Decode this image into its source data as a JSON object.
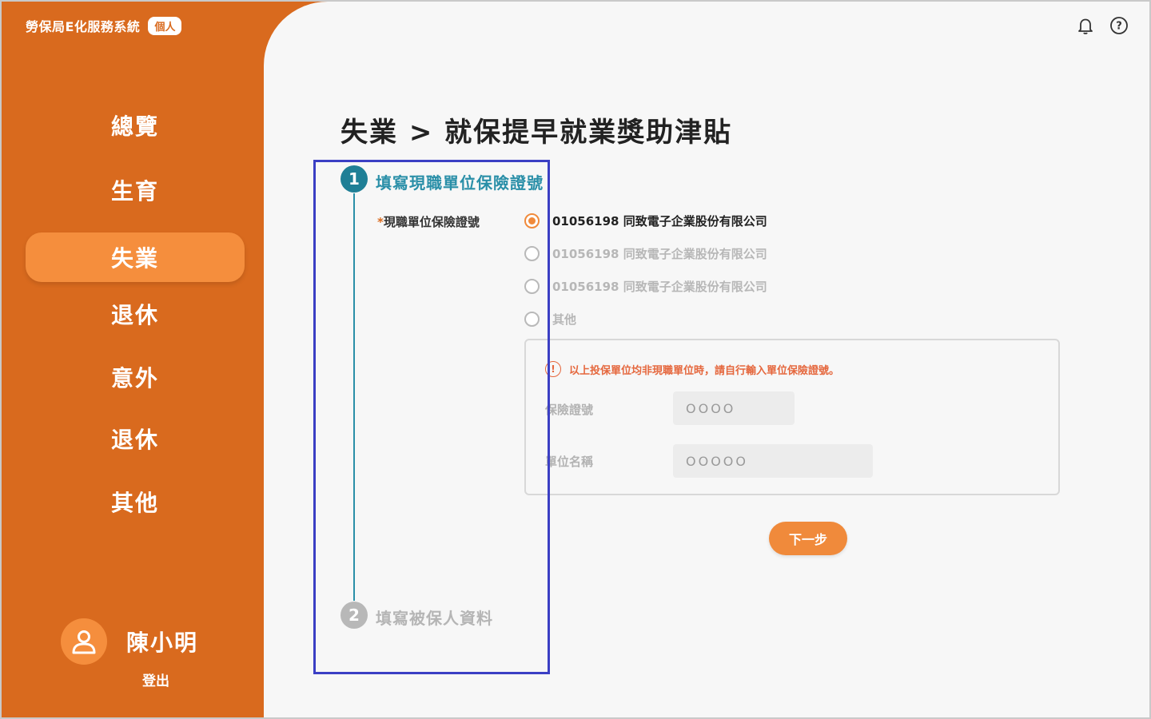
{
  "brand": {
    "title": "勞保局E化服務系統",
    "badge": "個人"
  },
  "nav": {
    "items": [
      {
        "label": "總覽"
      },
      {
        "label": "生育"
      },
      {
        "label": "失業"
      },
      {
        "label": "退休"
      },
      {
        "label": "意外"
      },
      {
        "label": "退休"
      },
      {
        "label": "其他"
      }
    ],
    "active_index": 2
  },
  "user": {
    "name": "陳小明",
    "logout_label": "登出",
    "avatar_icon": "user-icon"
  },
  "header": {
    "notification_icon": "bell-icon",
    "help_icon": "question-icon",
    "help_glyph": "?"
  },
  "page": {
    "title": "失業 > 就保提早就業獎助津貼"
  },
  "stepper": {
    "steps": [
      {
        "number": "1",
        "label": "填寫現職單位保險證號"
      },
      {
        "number": "2",
        "label": "填寫被保人資料"
      }
    ]
  },
  "form": {
    "required_mark": "*",
    "field_label": "現職單位保險證號",
    "options": [
      {
        "label": "01056198 同致電子企業股份有限公司",
        "checked": true
      },
      {
        "label": "01056198 同致電子企業股份有限公司",
        "checked": false
      },
      {
        "label": "01056198 同致電子企業股份有限公司",
        "checked": false
      },
      {
        "label": "其他",
        "checked": false
      }
    ],
    "warning_glyph": "!",
    "warning": "以上投保單位均非現職單位時，請自行輸入單位保險證號。",
    "insurance_no_label": "保險證號",
    "insurance_no_value": "OOOO",
    "unit_name_label": "單位名稱",
    "unit_name_value": "OOOOO",
    "next_label": "下一步"
  },
  "colors": {
    "sidebar": "#d96a1e",
    "active": "#f58e3d",
    "accent": "#2a8fa8",
    "button": "#f08a3b",
    "warning": "#e5673d",
    "highlight": "#3b3fc4"
  }
}
